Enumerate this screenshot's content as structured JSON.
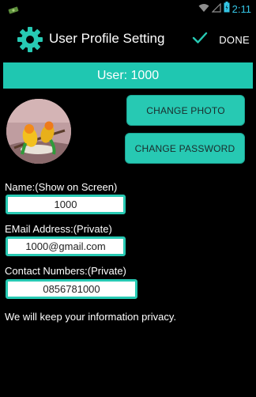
{
  "status_bar": {
    "time": "2:11",
    "icons": [
      "notification-icon",
      "wifi-icon",
      "signal-icon",
      "battery-icon"
    ]
  },
  "action_bar": {
    "title": "User Profile Setting",
    "done_label": "DONE",
    "icons": [
      "gear-icon",
      "check-icon"
    ]
  },
  "user_bar": {
    "label": "User: 1000"
  },
  "buttons": {
    "change_photo": "CHANGE PHOTO",
    "change_password": "CHANGE PASSWORD"
  },
  "form": {
    "name_label": "Name:(Show on Screen)",
    "name_value": "1000",
    "email_label": "EMail Address:(Private)",
    "email_value": "1000@gmail.com",
    "contact_label": "Contact Numbers:(Private)",
    "contact_value": "0856781000"
  },
  "privacy_note": "We will keep your information privacy.",
  "colors": {
    "accent": "#1fc7b1",
    "background": "#000000",
    "time": "#35c6e6"
  }
}
